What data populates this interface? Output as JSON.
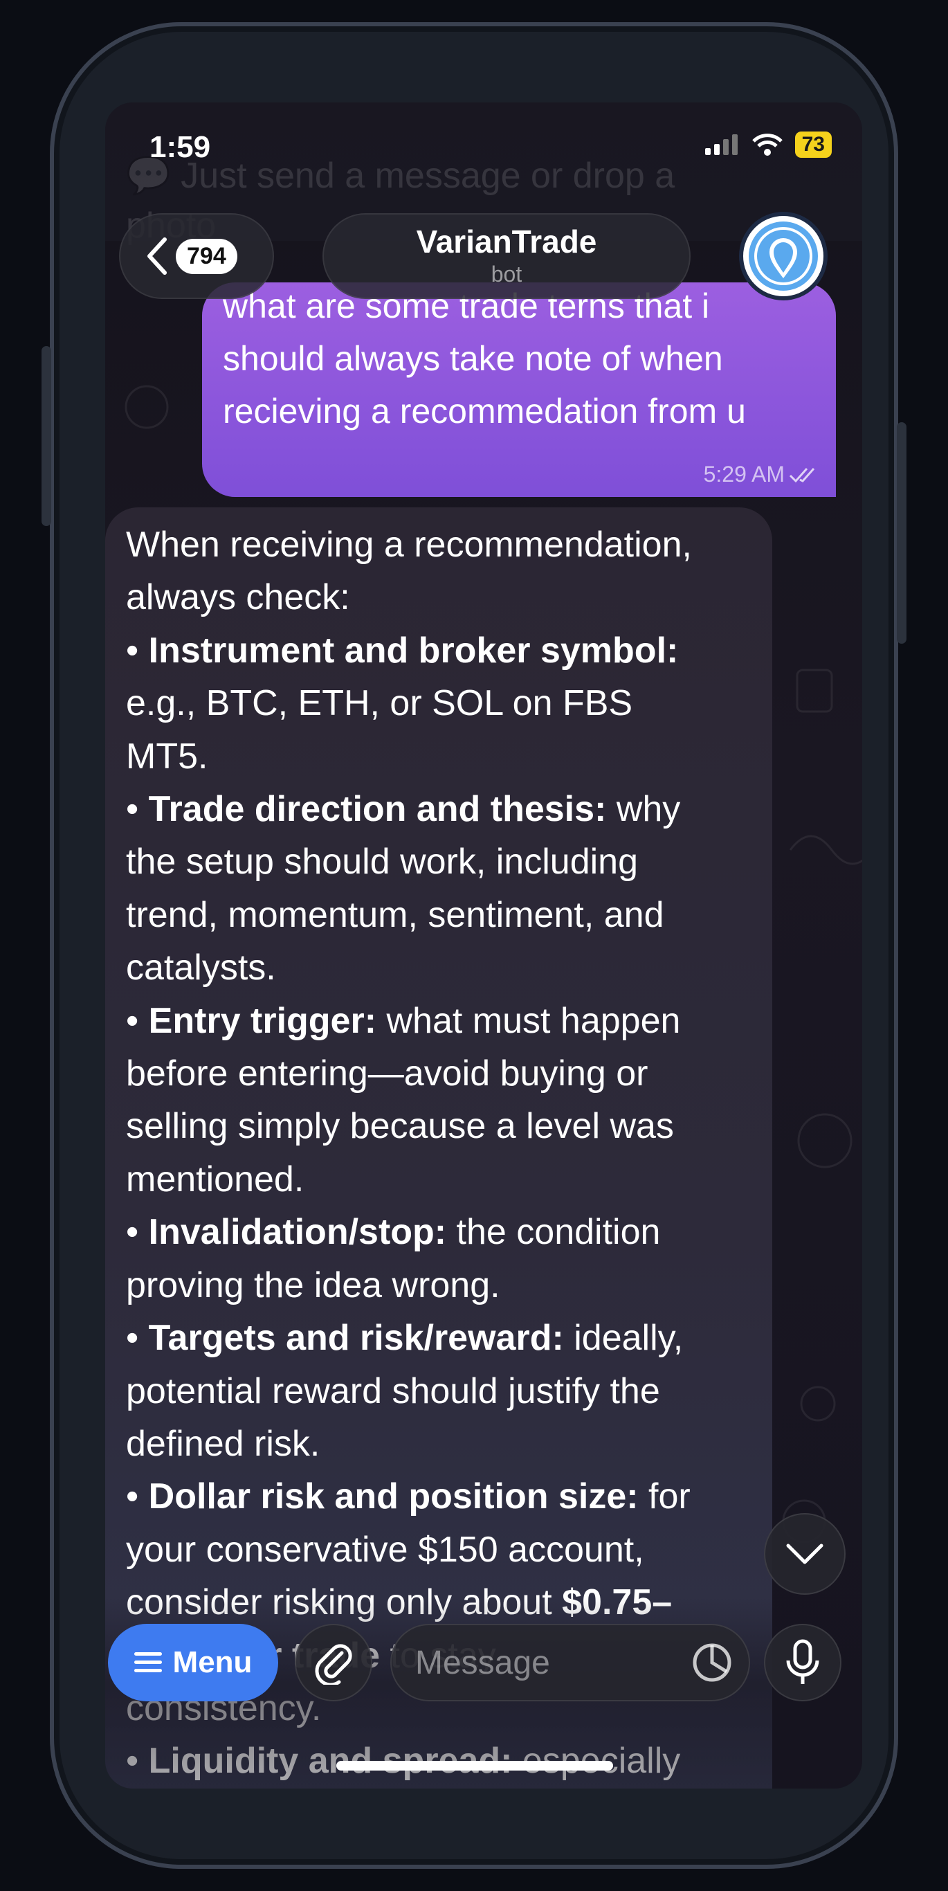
{
  "status": {
    "time": "1:59",
    "battery": "73"
  },
  "background": {
    "ghost_line_1": "💬 Just send a message or drop a",
    "ghost_line_2": "photo"
  },
  "header": {
    "back_count": "794",
    "chat_name": "VarianTrade",
    "chat_subtitle": "bot"
  },
  "outgoing": {
    "lines": [
      "what are some trade terns that i",
      "should always take note of when",
      "recieving a recommedation from u"
    ],
    "time": "5:29 AM"
  },
  "incoming": {
    "lines": [
      [
        {
          "t": "When receiving a recommendation,"
        }
      ],
      [
        {
          "t": "always check:"
        }
      ],
      [
        {
          "t": "• "
        },
        {
          "t": "Instrument and broker symbol:",
          "b": true
        }
      ],
      [
        {
          "t": "e.g., BTC, ETH, or SOL on FBS"
        }
      ],
      [
        {
          "t": "MT5."
        }
      ],
      [
        {
          "t": "• "
        },
        {
          "t": "Trade direction and thesis:",
          "b": true
        },
        {
          "t": " why"
        }
      ],
      [
        {
          "t": "the setup should work, including"
        }
      ],
      [
        {
          "t": "trend, momentum, sentiment, and"
        }
      ],
      [
        {
          "t": "catalysts."
        }
      ],
      [
        {
          "t": "• "
        },
        {
          "t": "Entry trigger:",
          "b": true
        },
        {
          "t": " what must happen"
        }
      ],
      [
        {
          "t": "before entering—avoid buying or"
        }
      ],
      [
        {
          "t": "selling simply because a level was"
        }
      ],
      [
        {
          "t": "mentioned."
        }
      ],
      [
        {
          "t": "• "
        },
        {
          "t": "Invalidation/stop:",
          "b": true
        },
        {
          "t": " the condition"
        }
      ],
      [
        {
          "t": "proving the idea wrong."
        }
      ],
      [
        {
          "t": "• "
        },
        {
          "t": "Targets and risk/reward:",
          "b": true
        },
        {
          "t": " ideally,"
        }
      ],
      [
        {
          "t": "potential reward should justify the"
        }
      ],
      [
        {
          "t": "defined risk."
        }
      ],
      [
        {
          "t": "• "
        },
        {
          "t": "Dollar risk and position size:",
          "b": true
        },
        {
          "t": " for"
        }
      ],
      [
        {
          "t": "your conservative $150 account,"
        }
      ],
      [
        {
          "t": "consider risking only about "
        },
        {
          "t": "$0.75–",
          "b": true
        }
      ],
      [
        {
          "t": "$1.50 per trade",
          "b": true
        },
        {
          "t": " to stay"
        }
      ],
      [
        {
          "t": "consistency."
        }
      ],
      [
        {
          "t": "• "
        },
        {
          "t": "Liquidity and spread:",
          "b": true
        },
        {
          "t": " especially"
        }
      ]
    ]
  },
  "input_bar": {
    "menu_label": "Menu",
    "message_placeholder": "Message"
  }
}
